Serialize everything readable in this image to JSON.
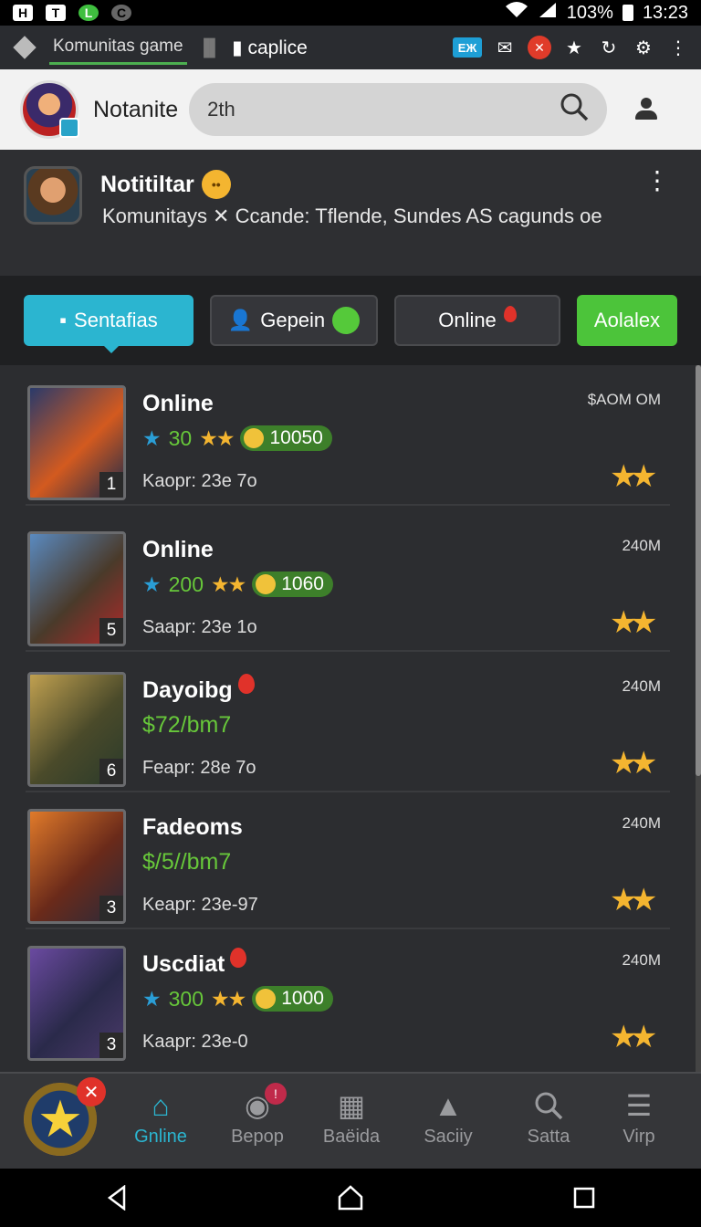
{
  "status_bar": {
    "battery": "103%",
    "time": "13:23",
    "left_icons": [
      "H",
      "T",
      "L",
      "C"
    ]
  },
  "browser": {
    "active_tab": "Komunitas game",
    "url": "caplice",
    "tab_badge": "EЖ"
  },
  "header": {
    "title": "Notanite",
    "search_query": "2th"
  },
  "notification": {
    "name": "Notitiltar",
    "message": "Komunitays ✕ Ccande: Tflende, Sundes AS cagunds oe"
  },
  "filters": [
    {
      "label": "Sentafias",
      "active": true
    },
    {
      "label": "Gepein"
    },
    {
      "label": "Online"
    },
    {
      "label": "Aolalex"
    }
  ],
  "list": [
    {
      "title": "Online",
      "stars_num": "30",
      "coins": "10050",
      "sub": "Kaopr: 23e 7o",
      "size": "$AOM OM",
      "badge": "1",
      "pin": false
    },
    {
      "title": "Online",
      "stars_num": "200",
      "coins": "1060",
      "sub": "Saapr: 23e 1o",
      "size": "240M",
      "badge": "5",
      "pin": false
    },
    {
      "title": "Dayoibg",
      "price": "$72/bm7",
      "sub": "Feapr: 28e 7o",
      "size": "240M",
      "badge": "6",
      "pin": true
    },
    {
      "title": "Fadeoms",
      "price": "$/5//bm7",
      "sub": "Keapr: 23e-97",
      "size": "240M",
      "badge": "3",
      "pin": false
    },
    {
      "title": "Uscdiat",
      "stars_num": "300",
      "coins": "1000",
      "sub": "Kaapr: 23e-0",
      "size": "240M",
      "badge": "3",
      "pin": true
    }
  ],
  "bottom_nav": [
    {
      "label": "Gnline",
      "icon": "home-icon",
      "active": true
    },
    {
      "label": "Bepop",
      "icon": "location-icon",
      "notify": "!"
    },
    {
      "label": "Baëida",
      "icon": "blocks-icon"
    },
    {
      "label": "Saciiy",
      "icon": "triangle-icon"
    },
    {
      "label": "Satta",
      "icon": "search-icon"
    },
    {
      "label": "Virp",
      "icon": "menu-icon"
    }
  ],
  "colors": {
    "accent": "#2bb5d0",
    "green": "#4cc43a",
    "star": "#f4b530",
    "header_bg": "#f2f2f2",
    "panel_bg": "#2c2d30"
  }
}
